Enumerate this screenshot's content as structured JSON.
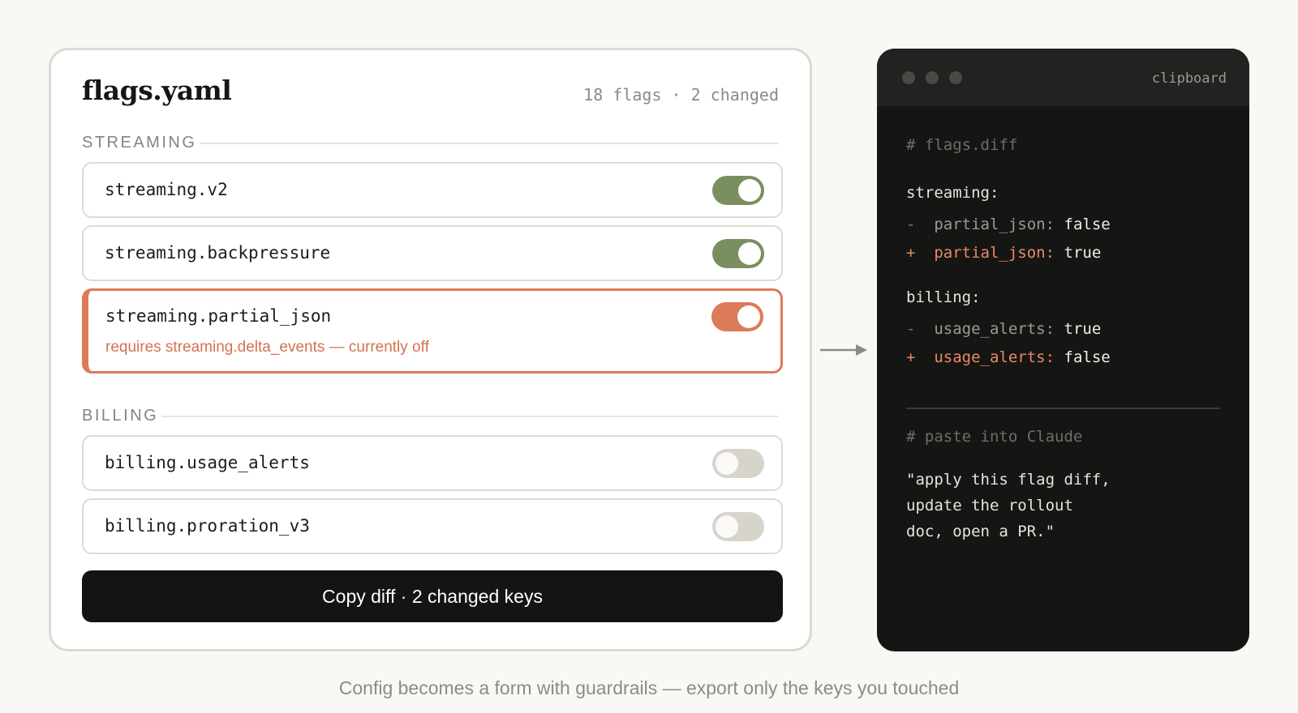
{
  "card": {
    "title": "flags.yaml",
    "meta": "18 flags · 2 changed"
  },
  "sections": {
    "streaming": "STREAMING",
    "billing": "BILLING"
  },
  "flags": [
    {
      "name": "streaming.v2",
      "state": "on"
    },
    {
      "name": "streaming.backpressure",
      "state": "on"
    },
    {
      "name": "streaming.partial_json",
      "state": "on",
      "warning": "requires streaming.delta_events — currently off"
    },
    {
      "name": "billing.usage_alerts",
      "state": "off"
    },
    {
      "name": "billing.proration_v3",
      "state": "off"
    }
  ],
  "copy_button": "Copy diff · 2 changed keys",
  "clipboard": {
    "title": "clipboard",
    "diff_comment": "# flags.diff",
    "streaming_header": "streaming:",
    "streaming_removed": {
      "sign": "-",
      "key": "partial_json:",
      "value": "false"
    },
    "streaming_added": {
      "sign": "+",
      "key": "partial_json:",
      "value": "true"
    },
    "billing_header": "billing:",
    "billing_removed": {
      "sign": "-",
      "key": "usage_alerts:",
      "value": "true"
    },
    "billing_added": {
      "sign": "+",
      "key": "usage_alerts:",
      "value": "false"
    },
    "paste_comment": "# paste into Claude",
    "prompt_lines": [
      "\"apply this flag diff,",
      "update the rollout",
      "doc, open a PR.\""
    ]
  },
  "caption": "Config becomes a form with guardrails — export only the keys you touched",
  "colors": {
    "toggle_on": "#7a8e5f",
    "toggle_warn": "#dd7a58",
    "toggle_off": "#d7d4cc",
    "accent": "#de7a58"
  }
}
